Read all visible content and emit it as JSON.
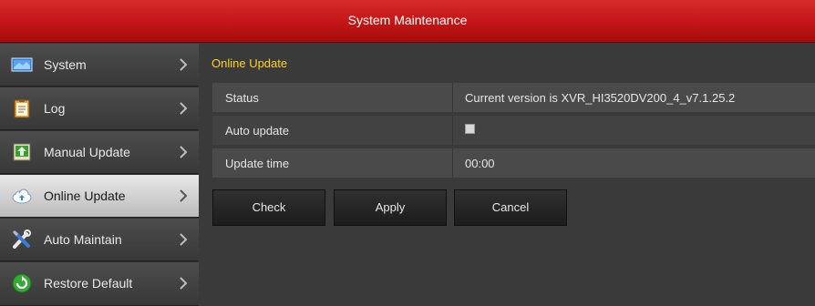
{
  "window": {
    "title": "System Maintenance"
  },
  "sidebar": {
    "items": [
      {
        "label": "System",
        "icon": "monitor-icon"
      },
      {
        "label": "Log",
        "icon": "log-clipboard-icon"
      },
      {
        "label": "Manual Update",
        "icon": "upload-arrow-icon"
      },
      {
        "label": "Online Update",
        "icon": "cloud-icon",
        "active": true
      },
      {
        "label": "Auto Maintain",
        "icon": "tools-icon"
      },
      {
        "label": "Restore Default",
        "icon": "restore-icon"
      }
    ]
  },
  "main": {
    "section_title": "Online Update",
    "rows": [
      {
        "label": "Status",
        "value": "Current version is XVR_HI3520DV200_4_v7.1.25.2"
      },
      {
        "label": "Auto update",
        "checked": false
      },
      {
        "label": "Update time",
        "value": "00:00"
      }
    ],
    "buttons": {
      "check": "Check",
      "apply": "Apply",
      "cancel": "Cancel"
    }
  },
  "colors": {
    "title_bar": "#c21616",
    "section_title": "#ffd21e"
  }
}
